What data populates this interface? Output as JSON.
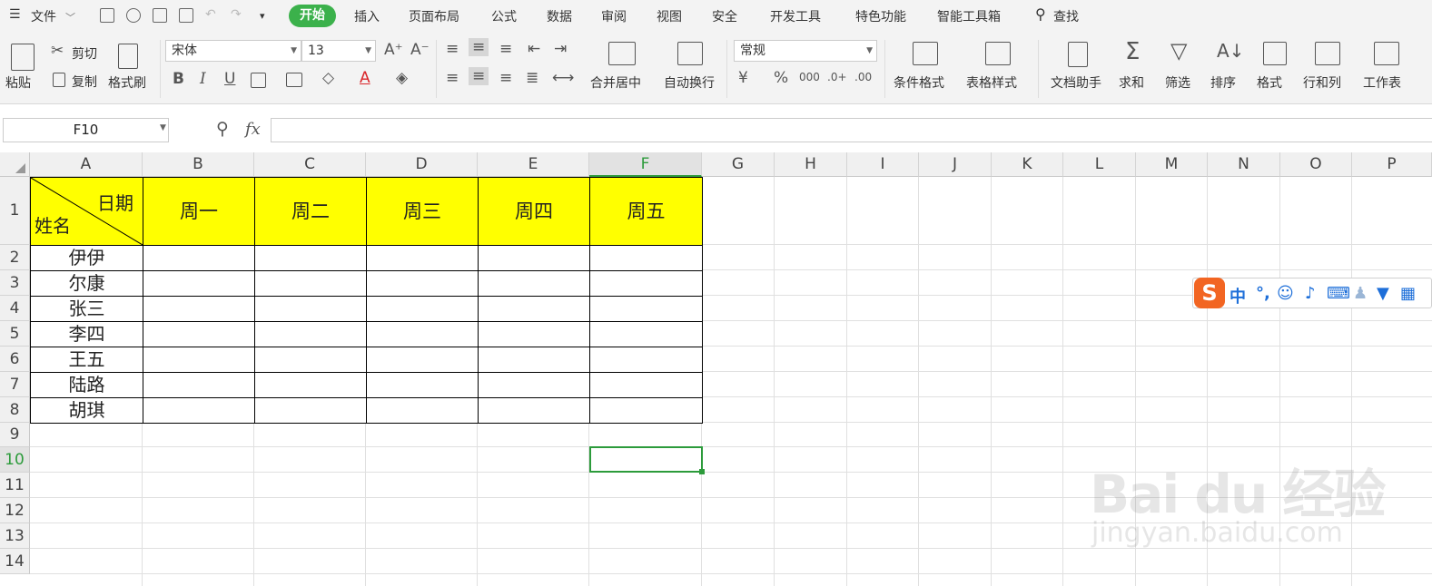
{
  "menubar": {
    "file_label": "文件",
    "tabs": [
      "开始",
      "插入",
      "页面布局",
      "公式",
      "数据",
      "审阅",
      "视图",
      "安全",
      "开发工具",
      "特色功能",
      "智能工具箱"
    ],
    "search_label": "查找"
  },
  "ribbon": {
    "paste": "粘贴",
    "cut": "剪切",
    "copy": "复制",
    "format_painter": "格式刷",
    "font_name": "宋体",
    "font_size": "13",
    "bold": "B",
    "italic": "I",
    "underline": "U",
    "merge_center": "合并居中",
    "auto_wrap": "自动换行",
    "number_format": "常规",
    "currency_symbol": "¥",
    "percent_symbol": "%",
    "conditional_format": "条件格式",
    "table_style": "表格样式",
    "doc_assistant": "文档助手",
    "sum": "求和",
    "filter": "筛选",
    "sort": "排序",
    "format": "格式",
    "row_col": "行和列",
    "worksheet": "工作表"
  },
  "formula_bar": {
    "name_box": "F10",
    "fx_label": "fx",
    "formula": ""
  },
  "sheet": {
    "columns": [
      "A",
      "B",
      "C",
      "D",
      "E",
      "F",
      "G",
      "H",
      "I",
      "J",
      "K",
      "L",
      "M",
      "N",
      "O",
      "P"
    ],
    "rows": [
      "1",
      "2",
      "3",
      "4",
      "5",
      "6",
      "7",
      "8",
      "9",
      "10",
      "11",
      "12",
      "13",
      "14"
    ],
    "diag_header_top": "日期",
    "diag_header_bottom": "姓名",
    "day_headers": [
      "周一",
      "周二",
      "周三",
      "周四",
      "周五"
    ],
    "names": [
      "伊伊",
      "尔康",
      "张三",
      "李四",
      "王五",
      "陆路",
      "胡琪"
    ],
    "selected_cell": "F10"
  },
  "ime_toolbar": {
    "logo": "S",
    "mode": "中",
    "punct": "°,"
  },
  "watermark": {
    "main": "Bai du 经验",
    "sub": "jingyan.baidu.com"
  },
  "colors": {
    "accent_green": "#3bb14b",
    "header_yellow": "#ffff00",
    "ime_orange": "#f26522"
  }
}
